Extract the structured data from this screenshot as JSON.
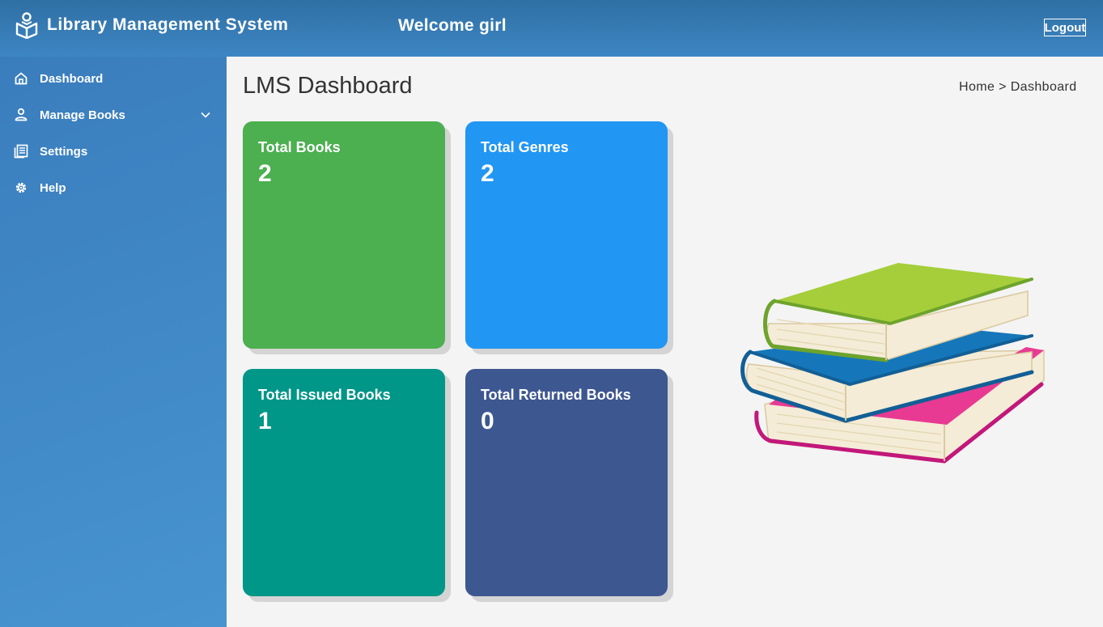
{
  "header": {
    "app_title": "Library Management System",
    "welcome_text": "Welcome girl",
    "logout_label": "Logout",
    "brand_icon": "book-reader-icon"
  },
  "sidebar": {
    "items": [
      {
        "label": "Dashboard",
        "icon": "home-icon"
      },
      {
        "label": "Manage Books",
        "icon": "user-icon",
        "has_submenu": true
      },
      {
        "label": "Settings",
        "icon": "document-icon"
      },
      {
        "label": "Help",
        "icon": "gear-icon"
      }
    ]
  },
  "main": {
    "title": "LMS Dashboard",
    "breadcrumb": "Home > Dashboard",
    "cards": [
      {
        "title": "Total Books",
        "value": "2",
        "color": "#4caf50"
      },
      {
        "title": "Total Genres",
        "value": "2",
        "color": "#2196f3"
      },
      {
        "title": "Total Issued Books",
        "value": "1",
        "color": "#009688"
      },
      {
        "title": "Total Returned Books",
        "value": "0",
        "color": "#3d5791"
      }
    ],
    "illustration": "stack-of-books"
  },
  "colors": {
    "header": "#3479b5",
    "sidebar": "#3f88c8",
    "background": "#f4f4f4"
  }
}
